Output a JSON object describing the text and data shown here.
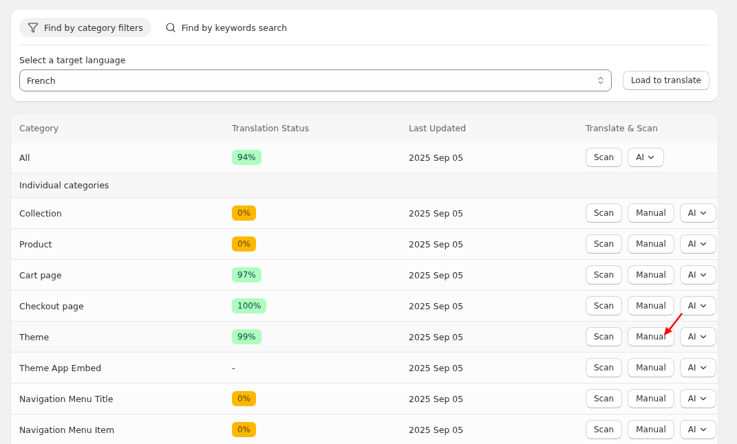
{
  "search_modes": [
    {
      "label": "Find by category filters",
      "selected": true
    },
    {
      "label": "Find by keywords search",
      "selected": false
    }
  ],
  "language": {
    "label": "Select a target language",
    "value": "French"
  },
  "load_button": "Load to translate",
  "table": {
    "columns": [
      "Category",
      "Translation Status",
      "Last Updated",
      "Translate & Scan"
    ],
    "rows": [
      {
        "kind": "row",
        "category": "All",
        "status": "94%",
        "color": "#affebf",
        "updated": "2025 Sep 05",
        "actions": [
          {
            "kind": "button",
            "label": "Scan"
          },
          {
            "kind": "menu",
            "label": "AI"
          }
        ],
        "arrow": false
      },
      {
        "kind": "section",
        "category": "Individual categories"
      },
      {
        "kind": "row",
        "category": "Collection",
        "status": "0%",
        "color": "#ffb800",
        "updated": "2025 Sep 05",
        "actions": [
          {
            "kind": "button",
            "label": "Scan"
          },
          {
            "kind": "button",
            "label": "Manual"
          },
          {
            "kind": "menu",
            "label": "AI"
          }
        ],
        "arrow": false
      },
      {
        "kind": "row",
        "category": "Product",
        "status": "0%",
        "color": "#ffb800",
        "updated": "2025 Sep 05",
        "actions": [
          {
            "kind": "button",
            "label": "Scan"
          },
          {
            "kind": "button",
            "label": "Manual"
          },
          {
            "kind": "menu",
            "label": "AI"
          }
        ],
        "arrow": false
      },
      {
        "kind": "row",
        "category": "Cart page",
        "status": "97%",
        "color": "#affebf",
        "updated": "2025 Sep 05",
        "actions": [
          {
            "kind": "button",
            "label": "Scan"
          },
          {
            "kind": "button",
            "label": "Manual"
          },
          {
            "kind": "menu",
            "label": "AI"
          }
        ],
        "arrow": false
      },
      {
        "kind": "row",
        "category": "Checkout page",
        "status": "100%",
        "color": "#affebf",
        "updated": "2025 Sep 05",
        "actions": [
          {
            "kind": "button",
            "label": "Scan"
          },
          {
            "kind": "button",
            "label": "Manual"
          },
          {
            "kind": "menu",
            "label": "AI"
          }
        ],
        "arrow": false
      },
      {
        "kind": "row",
        "category": "Theme",
        "status": "99%",
        "color": "#affebf",
        "updated": "2025 Sep 05",
        "actions": [
          {
            "kind": "button",
            "label": "Scan"
          },
          {
            "kind": "button",
            "label": "Manual"
          },
          {
            "kind": "menu",
            "label": "AI"
          }
        ],
        "arrow": true
      },
      {
        "kind": "row",
        "category": "Theme App Embed",
        "status": "-",
        "updated": "2025 Sep 05",
        "actions": [
          {
            "kind": "button",
            "label": "Scan"
          },
          {
            "kind": "button",
            "label": "Manual"
          },
          {
            "kind": "menu",
            "label": "AI"
          }
        ],
        "arrow": false
      },
      {
        "kind": "row",
        "category": "Navigation Menu Title",
        "status": "0%",
        "color": "#ffb800",
        "updated": "2025 Sep 05",
        "actions": [
          {
            "kind": "button",
            "label": "Scan"
          },
          {
            "kind": "button",
            "label": "Manual"
          },
          {
            "kind": "menu",
            "label": "AI"
          }
        ],
        "arrow": false
      },
      {
        "kind": "row",
        "category": "Navigation Menu Item",
        "status": "0%",
        "color": "#ffb800",
        "updated": "2025 Sep 05",
        "actions": [
          {
            "kind": "button",
            "label": "Scan"
          },
          {
            "kind": "button",
            "label": "Manual"
          },
          {
            "kind": "menu",
            "label": "AI"
          }
        ],
        "arrow": false
      }
    ]
  }
}
